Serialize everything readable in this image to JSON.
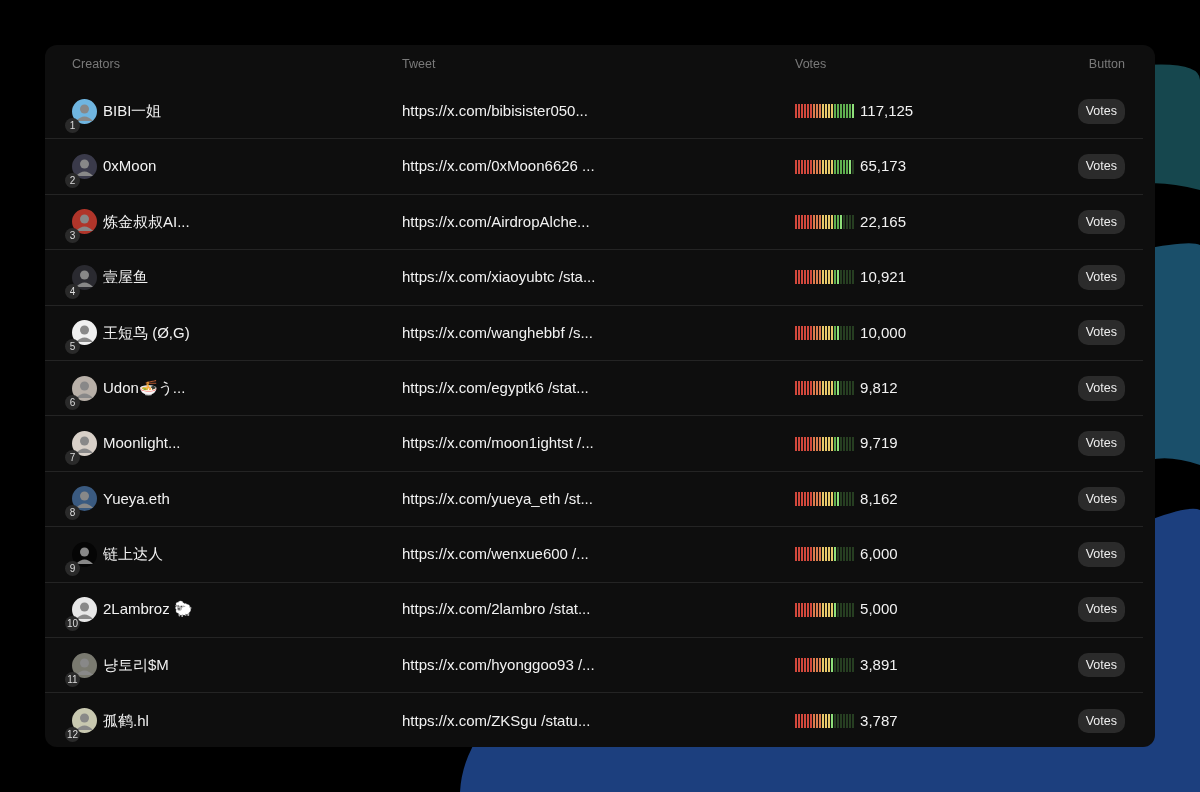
{
  "table": {
    "columns": [
      "Creators",
      "Tweet",
      "Votes",
      "Button"
    ],
    "rows": [
      {
        "rank": "1",
        "name": "BIBI一姐",
        "tweet": "https://x.com/bibisister050...",
        "level": 1.0,
        "votes": "117,125",
        "button": "Votes"
      },
      {
        "rank": "2",
        "name": "0xMoon",
        "tweet": "https://x.com/0xMoon6626 ...",
        "level": 0.95,
        "votes": "65,173",
        "button": "Votes"
      },
      {
        "rank": "3",
        "name": "炼金叔叔AI...",
        "tweet": "https://x.com/AirdropAlche...",
        "level": 0.8,
        "votes": "22,165",
        "button": "Votes"
      },
      {
        "rank": "4",
        "name": "壹屋鱼",
        "tweet": "https://x.com/xiaoyubtc /sta...",
        "level": 0.75,
        "votes": "10,921",
        "button": "Votes"
      },
      {
        "rank": "5",
        "name": "王短鸟 (Ø,G)",
        "tweet": "https://x.com/wanghebbf /s...",
        "level": 0.75,
        "votes": "10,000",
        "button": "Votes"
      },
      {
        "rank": "6",
        "name": "Udon🍜う...",
        "tweet": "https://x.com/egyptk6 /stat...",
        "level": 0.75,
        "votes": "9,812",
        "button": "Votes"
      },
      {
        "rank": "7",
        "name": "Moonlight...",
        "tweet": "https://x.com/moon1ightst /...",
        "level": 0.75,
        "votes": "9,719",
        "button": "Votes"
      },
      {
        "rank": "8",
        "name": "Yueya.eth",
        "tweet": "https://x.com/yueya_eth /st...",
        "level": 0.75,
        "votes": "8,162",
        "button": "Votes"
      },
      {
        "rank": "9",
        "name": "链上达人",
        "tweet": "https://x.com/wenxue600 /...",
        "level": 0.7,
        "votes": "6,000",
        "button": "Votes"
      },
      {
        "rank": "10",
        "name": "2Lambroz 🐑",
        "tweet": "https://x.com/2lambro /stat...",
        "level": 0.7,
        "votes": "5,000",
        "button": "Votes"
      },
      {
        "rank": "11",
        "name": "냥토리$M",
        "tweet": "https://x.com/hyonggoo93 /...",
        "level": 0.65,
        "votes": "3,891",
        "button": "Votes"
      },
      {
        "rank": "12",
        "name": "孤鹤.hl",
        "tweet": "https://x.com/ZKSgu /statu...",
        "level": 0.65,
        "votes": "3,787",
        "button": "Votes"
      }
    ]
  }
}
